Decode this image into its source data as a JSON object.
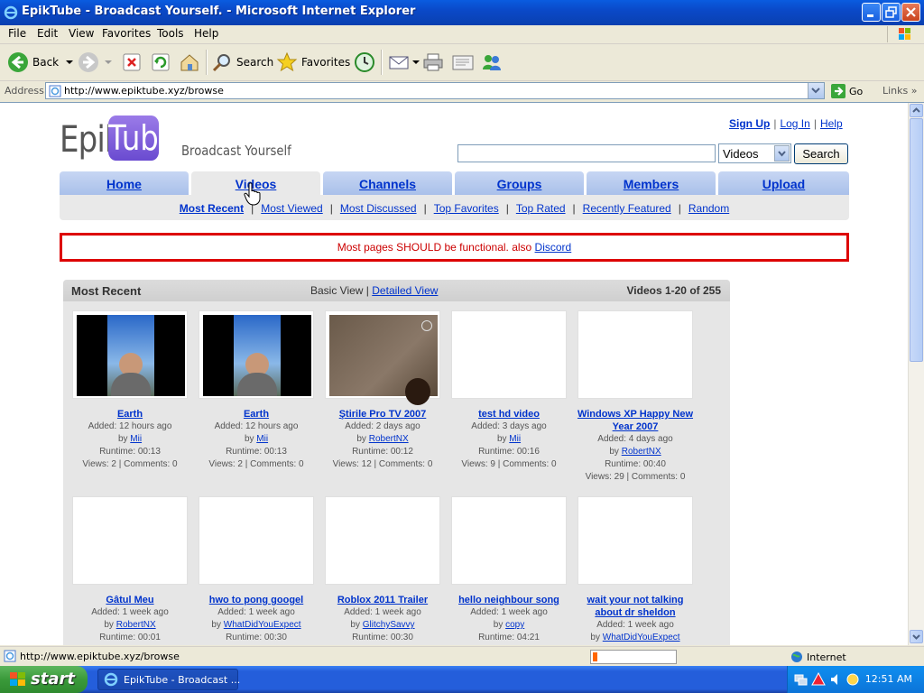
{
  "window": {
    "title": "EpikTube - Broadcast Yourself. - Microsoft Internet Explorer"
  },
  "menu": [
    "File",
    "Edit",
    "View",
    "Favorites",
    "Tools",
    "Help"
  ],
  "toolbar": {
    "back_label": "Back",
    "search_label": "Search",
    "favorites_label": "Favorites"
  },
  "address": {
    "label": "Address",
    "url": "http://www.epiktube.xyz/browse",
    "go_label": "Go",
    "links_label": "Links"
  },
  "site": {
    "logo_left": "Epik",
    "logo_right": "Tube",
    "tagline": "Broadcast Yourself",
    "top_links": {
      "signup": "Sign Up",
      "login": "Log In",
      "help": "Help"
    },
    "search": {
      "placeholder": "",
      "category": "Videos",
      "button": "Search"
    },
    "tabs": [
      "Home",
      "Videos",
      "Channels",
      "Groups",
      "Members",
      "Upload"
    ],
    "subnav": [
      "Most Recent",
      "Most Viewed",
      "Most Discussed",
      "Top Favorites",
      "Top Rated",
      "Recently Featured",
      "Random"
    ],
    "notice": {
      "text": "Most pages SHOULD be functional. also ",
      "link": "Discord"
    },
    "recent": {
      "title": "Most Recent",
      "basic_view": "Basic View |",
      "detailed_view": "Detailed View",
      "count": "Videos 1-20 of 255"
    },
    "videos": [
      {
        "title": "Earth",
        "added": "Added: 12 hours ago",
        "by": "by",
        "user": "Mii",
        "runtime": "Runtime: 00:13",
        "stats": "Views: 2 | Comments: 0",
        "thumb": "person"
      },
      {
        "title": "Earth",
        "added": "Added: 12 hours ago",
        "by": "by",
        "user": "Mii",
        "runtime": "Runtime: 00:13",
        "stats": "Views: 2 | Comments: 0",
        "thumb": "person"
      },
      {
        "title": "Ştirile Pro TV 2007",
        "added": "Added: 2 days ago",
        "by": "by",
        "user": "RobertNX",
        "runtime": "Runtime: 00:12",
        "stats": "Views: 12 | Comments: 0",
        "thumb": "brown"
      },
      {
        "title": "test hd video",
        "added": "Added: 3 days ago",
        "by": "by",
        "user": "Mii",
        "runtime": "Runtime: 00:16",
        "stats": "Views: 9 | Comments: 0",
        "thumb": "blank"
      },
      {
        "title": "Windows XP Happy New Year 2007",
        "added": "Added: 4 days ago",
        "by": "by",
        "user": "RobertNX",
        "runtime": "Runtime: 00:40",
        "stats": "Views: 29 | Comments: 0",
        "thumb": "blank"
      },
      {
        "title": "Gâtul Meu",
        "added": "Added: 1 week ago",
        "by": "by",
        "user": "RobertNX",
        "runtime": "Runtime: 00:01",
        "stats": "",
        "thumb": "blank"
      },
      {
        "title": "hwo to pong googel",
        "added": "Added: 1 week ago",
        "by": "by",
        "user": "WhatDidYouExpect",
        "runtime": "Runtime: 00:30",
        "stats": "",
        "thumb": "blank"
      },
      {
        "title": "Roblox 2011 Trailer",
        "added": "Added: 1 week ago",
        "by": "by",
        "user": "GlitchySavvy",
        "runtime": "Runtime: 00:30",
        "stats": "",
        "thumb": "blank"
      },
      {
        "title": "hello neighbour song",
        "added": "Added: 1 week ago",
        "by": "by",
        "user": "copy",
        "runtime": "Runtime: 04:21",
        "stats": "",
        "thumb": "blank"
      },
      {
        "title": "wait your not talking about dr sheldon",
        "added": "Added: 1 week ago",
        "by": "by",
        "user": "WhatDidYouExpect",
        "runtime": "",
        "stats": "",
        "thumb": "blank"
      }
    ]
  },
  "status": {
    "text": "http://www.epiktube.xyz/browse",
    "zone": "Internet",
    "progress": 0.05
  },
  "taskbar": {
    "start": "start",
    "task": "EpikTube - Broadcast ...",
    "clock": "12:51 AM"
  },
  "colors": {
    "link": "#0033cc",
    "notice_border": "#dd0000",
    "tab_bg": "#a9c0ea",
    "logo_purple": "#7a5be0"
  }
}
